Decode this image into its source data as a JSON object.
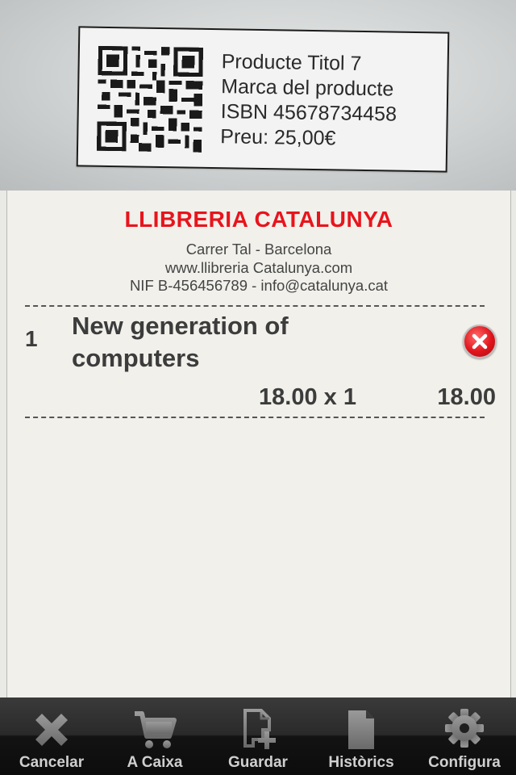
{
  "scan_label": {
    "lines": [
      "Producte Titol 7",
      "Marca del producte",
      "ISBN 45678734458",
      "Preu: 25,00€"
    ]
  },
  "receipt": {
    "shop_name": "LLIBRERIA CATALUNYA",
    "info": [
      "Carrer Tal - Barcelona",
      "www.llibreria Catalunya.com",
      "NIF B-456456789 - info@catalunya.cat"
    ],
    "items": [
      {
        "index": "1",
        "title_lines": [
          "New generation of",
          "computers"
        ],
        "qty_text": "18.00 x 1",
        "total": "18.00"
      }
    ]
  },
  "tabbar": {
    "tabs": [
      {
        "label": "Cancelar",
        "icon": "close-icon"
      },
      {
        "label": "A Caixa",
        "icon": "cart-icon"
      },
      {
        "label": "Guardar",
        "icon": "add-document-icon"
      },
      {
        "label": "Històrics",
        "icon": "document-icon"
      },
      {
        "label": "Configura",
        "icon": "gear-icon"
      }
    ]
  },
  "colors": {
    "brand_red": "#e8141c",
    "receipt_bg": "#f1f0eb",
    "tabbar_bg": "#1c1c1c"
  }
}
